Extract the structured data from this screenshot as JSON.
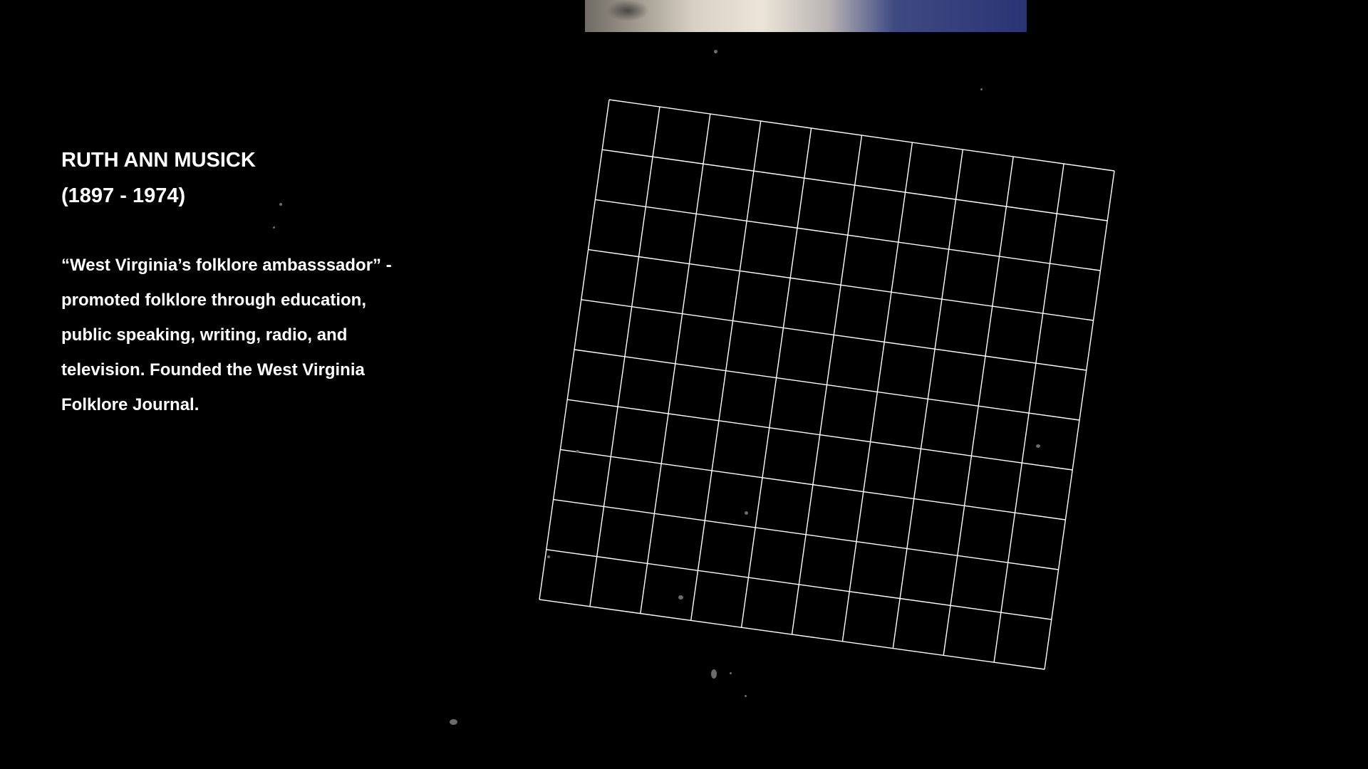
{
  "bio": {
    "name": "RUTH ANN MUSICK",
    "years": "(1897 - 1974)",
    "description": "“West Virginia’s folklore ambasssador” -\npromoted folklore through education,\npublic speaking, writing, radio, and\ntelevision. Founded the West Virginia\nFolklore Journal."
  },
  "grid": {
    "rows": 10,
    "cols": 10,
    "line_color": "#ffffff"
  },
  "colors": {
    "background": "#000000",
    "text": "#ffffff"
  }
}
